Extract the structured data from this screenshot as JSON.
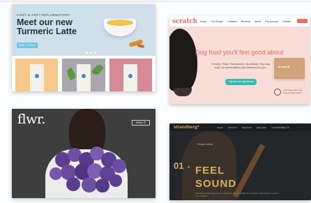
{
  "card1": {
    "eyebrow": "COZY & ANTI-INFLAMMATORY",
    "heading": "Meet our new Turmeric Latte",
    "cta": "FIND A CAFE",
    "tile_colors": [
      "#f6c98b",
      "#a9a6ad",
      "#d98995"
    ],
    "accent": "#6ec6e0"
  },
  "card2": {
    "logo": "scratch",
    "nav": [
      "Home",
      "Our Recipe",
      "Contains",
      "Reviews",
      "About",
      "Pty account",
      "Contact"
    ],
    "heading": "Dog food you'll feel good about",
    "sub": "Fresher. Real. Transparent. Australian. Dry dog food, on subscription and delivered to you.",
    "cta": "Sign me the ingredients",
    "box_label": "scratch",
    "badge_text": "Formulated with a Vet. Independently tested",
    "accent": "#f26b5b"
  },
  "card3": {
    "logo": "flwr.",
    "menu": "MENU ☰"
  },
  "card4": {
    "logo": "strandberg*",
    "nav": [
      "SHOP",
      "ARTISTS",
      "DESIGNS",
      "DEALERS",
      "SUPPORT"
    ],
    "nav_right": "SEK ▾ ☰",
    "small": "Feature article",
    "number": "01",
    "title1": "FEEL",
    "title2": "SOUND",
    "body": "Strandberg guitars are built on ergonomics, natural design and innovative engineering to support your creativity.",
    "accent": "#d4b063"
  }
}
